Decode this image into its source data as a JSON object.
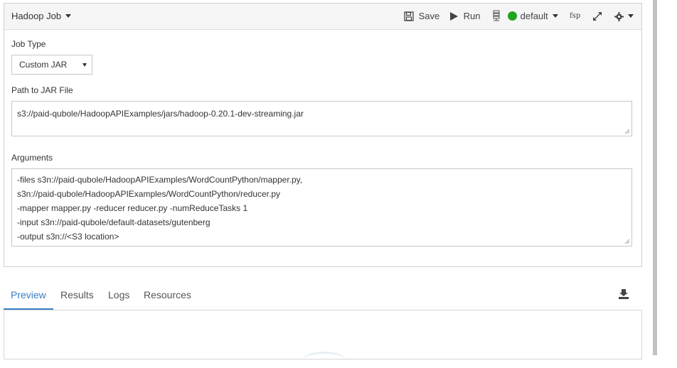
{
  "toolbar": {
    "job_type_menu": "Hadoop Job",
    "save_label": "Save",
    "run_label": "Run",
    "cluster_label": "default",
    "fsp_label": "fsp",
    "status_color": "#1fa51f"
  },
  "form": {
    "job_type_label": "Job Type",
    "job_type_value": "Custom JAR",
    "jar_path_label": "Path to JAR File",
    "jar_path_value": "s3://paid-qubole/HadoopAPIExamples/jars/hadoop-0.20.1-dev-streaming.jar",
    "arguments_label": "Arguments",
    "arguments_lines": [
      "-files s3n://paid-qubole/HadoopAPIExamples/WordCountPython/mapper.py,",
      "s3n://paid-qubole/HadoopAPIExamples/WordCountPython/reducer.py",
      "-mapper mapper.py -reducer reducer.py -numReduceTasks 1",
      "-input s3n://paid-qubole/default-datasets/gutenberg",
      "-output s3n://<S3 location>"
    ]
  },
  "tabs": [
    {
      "label": "Preview",
      "active": true
    },
    {
      "label": "Results",
      "active": false
    },
    {
      "label": "Logs",
      "active": false
    },
    {
      "label": "Resources",
      "active": false
    }
  ],
  "colors": {
    "accent": "#3a7fc4",
    "toolbar_bg": "#f5f5f5"
  }
}
